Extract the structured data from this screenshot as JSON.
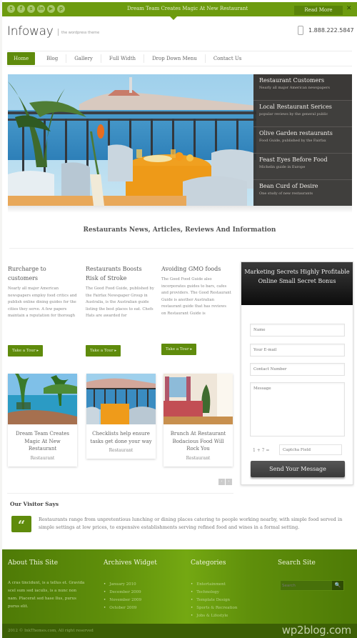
{
  "topbar": {
    "social_icons": [
      "twitter-icon",
      "facebook-icon",
      "skype-icon",
      "linkedin-icon",
      "youtube-icon",
      "pinterest-icon"
    ],
    "social_glyphs": [
      "t",
      "f",
      "s",
      "in",
      "▶",
      "p"
    ],
    "announcement": "Dream Team Creates Magic At New Restaurant",
    "read_more_label": "Read More",
    "close_label": "✕",
    "accent_color": "#6d9b0f"
  },
  "header": {
    "logo": "Infoway",
    "tagline": "the wordpress theme",
    "phone": "1.888.222.5847"
  },
  "nav": {
    "items": [
      {
        "label": "Home",
        "active": true
      },
      {
        "label": "Blog"
      },
      {
        "label": "Gallery"
      },
      {
        "label": "Full Width"
      },
      {
        "label": "Drop Down Menu"
      },
      {
        "label": "Contact Us"
      }
    ]
  },
  "slider": {
    "items": [
      {
        "title": "Restaurant Customers",
        "subtitle": "Nearly all major American newspapers"
      },
      {
        "title": "Local Restaurant Serices",
        "subtitle": "popular reviews by the general public"
      },
      {
        "title": "Olive Garden restaurants",
        "subtitle": "Food Guide, published by the Fairfax"
      },
      {
        "title": "Feast Eyes Before Food",
        "subtitle": "Michelin guide in Europe"
      },
      {
        "title": "Bean Curd of Desire",
        "subtitle": "One study of new restaurants"
      }
    ]
  },
  "section_title": "Restaurants News, Articles, Reviews And Information",
  "articles": [
    {
      "title": "Rurcharge to customers",
      "body": "Nearly all major American newspapers employ food critics and publish online dining guides for the cities they serve. A few papers maintain a reputation for thorough",
      "button": "Take a Tour ▸"
    },
    {
      "title": "Restaurants Boosts Risk of Stroke",
      "body": "The Good Food Guide, published by the Fairfax Newspaper Group in Australia, is the Australian guide listing the best places to eat. Chefs Hats are awarded for",
      "button": "Take a Tour ▸"
    },
    {
      "title": "Avoiding GMO foods",
      "body": "The Good Food Guide also incorporates guides to bars, cafes and providers. The Good Restaurant Guide is another Australian restaurant guide that has reviews on Restaurant Guide is",
      "button": "Take a Tour ▸"
    }
  ],
  "contact_form": {
    "heading": "Marketing Secrets Highly Profitable Online Small Secret Bonus",
    "name_placeholder": "Name",
    "email_placeholder": "Your E-mail",
    "phone_placeholder": "Contact Number",
    "message_placeholder": "Message",
    "captcha_question": "1 + 7  =",
    "captcha_placeholder": "Captcha Field",
    "submit_label": "Send Your Message"
  },
  "gallery": {
    "cards": [
      {
        "title": "Dream Team Creates Magic At New Restaurant",
        "category": "Restaurant",
        "image": "pool-resort-photo"
      },
      {
        "title": "Checklists help ensure tasks get done your way",
        "category": "Restaurant",
        "image": "terrace-table-photo"
      },
      {
        "title": "Brunch At Restaurant Bodacious Food Will Rock You",
        "category": "Restaurant",
        "image": "bedroom-photo"
      }
    ],
    "prev_label": "‹",
    "next_label": "›"
  },
  "testimonial": {
    "title": "Our Visitor Says",
    "quote_glyph": "“",
    "text": "Restaurants range from unpretentious lunching or dining places catering to people working nearby, with simple food served in simple settings at low prices, to expensive establishments serving refined food and wines in a formal setting."
  },
  "footer": {
    "about": {
      "title": "About This Site",
      "text": "A cras tincidunt, is a tellus et. Gravida scel sum sed iaculis, is a nunc non nam. Placerat sed hase llus, purus purus elit."
    },
    "archives": {
      "title": "Archives Widget",
      "items": [
        "January 2010",
        "December 2009",
        "November 2009",
        "October 2009"
      ]
    },
    "categories": {
      "title": "Categories",
      "items": [
        "Entertainment",
        "Technology",
        "Template Design",
        "Sports & Recreation",
        "Jobs & Lifestyle"
      ]
    },
    "search": {
      "title": "Search Site",
      "placeholder": "Search",
      "button_glyph": "🔍"
    },
    "copyright": "2012 © InkThemes.com, All right reserved",
    "watermark": "wp2blog.com"
  }
}
